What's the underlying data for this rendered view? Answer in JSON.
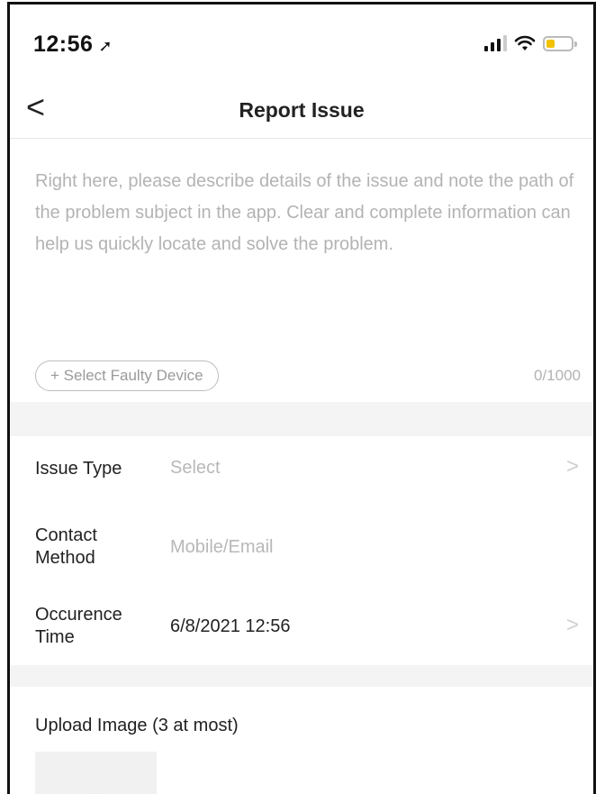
{
  "status_bar": {
    "time": "12:56",
    "location_glyph": "➚"
  },
  "nav": {
    "back_glyph": "<",
    "title": "Report Issue"
  },
  "description": {
    "placeholder": "Right here, please describe details of the issue and note the path of the problem subject in the app. Clear and complete information can help us quickly locate and solve the problem.",
    "select_device_label": "+ Select Faulty Device",
    "char_count": "0/1000"
  },
  "form": {
    "issue_type": {
      "label": "Issue Type",
      "value": "Select"
    },
    "contact_method": {
      "label": "Contact Method",
      "value": "Mobile/Email"
    },
    "occurrence_time": {
      "label": "Occurence Time",
      "value": "6/8/2021 12:56"
    }
  },
  "upload": {
    "title": "Upload Image (3 at most)",
    "add_glyph": "+"
  },
  "colors": {
    "battery_fill": "#f2c200",
    "placeholder_text": "#b3b3b3",
    "section_gap": "#f4f4f4"
  },
  "battery_level": 0.35,
  "signal_bars_active": 3
}
